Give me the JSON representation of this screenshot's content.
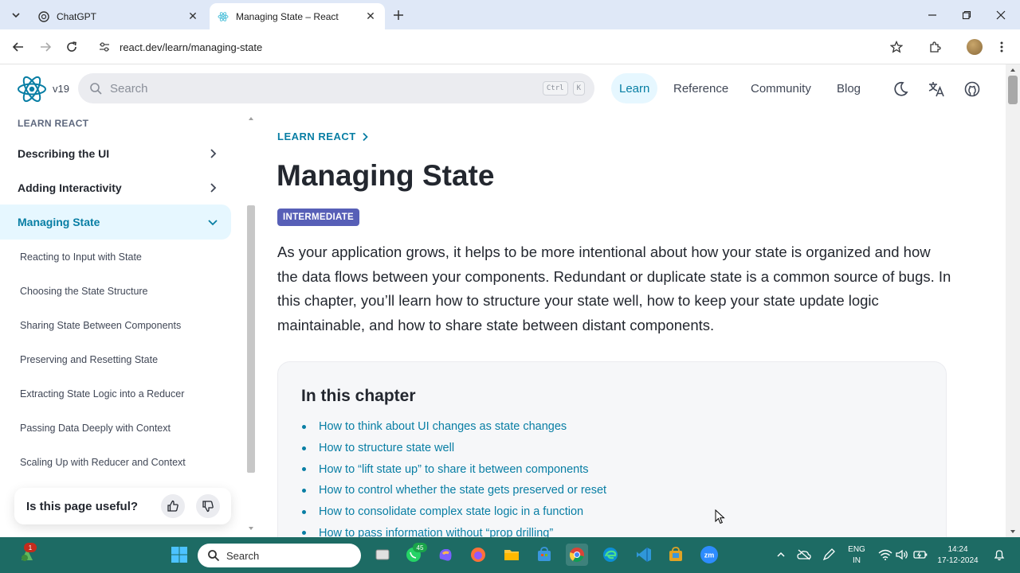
{
  "browser": {
    "tabs": [
      {
        "title": "ChatGPT",
        "active": false
      },
      {
        "title": "Managing State – React",
        "active": true
      }
    ],
    "url": "react.dev/learn/managing-state"
  },
  "site": {
    "version": "v19",
    "search_placeholder": "Search",
    "kbd_ctrl": "Ctrl",
    "kbd_k": "K",
    "nav": [
      "Learn",
      "Reference",
      "Community",
      "Blog"
    ],
    "active_nav": "Learn"
  },
  "sidebar": {
    "section": "LEARN REACT",
    "top_items": [
      "Describing the UI",
      "Adding Interactivity",
      "Managing State"
    ],
    "active_item": "Managing State",
    "sub_items": [
      "Reacting to Input with State",
      "Choosing the State Structure",
      "Sharing State Between Components",
      "Preserving and Resetting State",
      "Extracting State Logic into a Reducer",
      "Passing Data Deeply with Context",
      "Scaling Up with Reducer and Context"
    ],
    "feedback_question": "Is this page useful?"
  },
  "main": {
    "breadcrumb": "LEARN REACT",
    "title": "Managing State",
    "badge": "INTERMEDIATE",
    "intro": "As your application grows, it helps to be more intentional about how your state is organized and how the data flows between your components. Redundant or duplicate state is a common source of bugs. In this chapter, you’ll learn how to structure your state well, how to keep your state update logic maintainable, and how to share state between distant components.",
    "chapter_heading": "In this chapter",
    "chapter_links": [
      "How to think about UI changes as state changes",
      "How to structure state well",
      "How to “lift state up” to share it between components",
      "How to control whether the state gets preserved or reset",
      "How to consolidate complex state logic in a function",
      "How to pass information without “prop drilling”"
    ]
  },
  "taskbar": {
    "search_label": "Search",
    "notification_count": "1",
    "whatsapp_badge": "45",
    "language_line1": "ENG",
    "language_line2": "IN",
    "time": "14:24",
    "date": "17-12-2024"
  },
  "colors": {
    "accent": "#087ea4",
    "badge": "#575fb7",
    "taskbar": "#1d6b64"
  }
}
